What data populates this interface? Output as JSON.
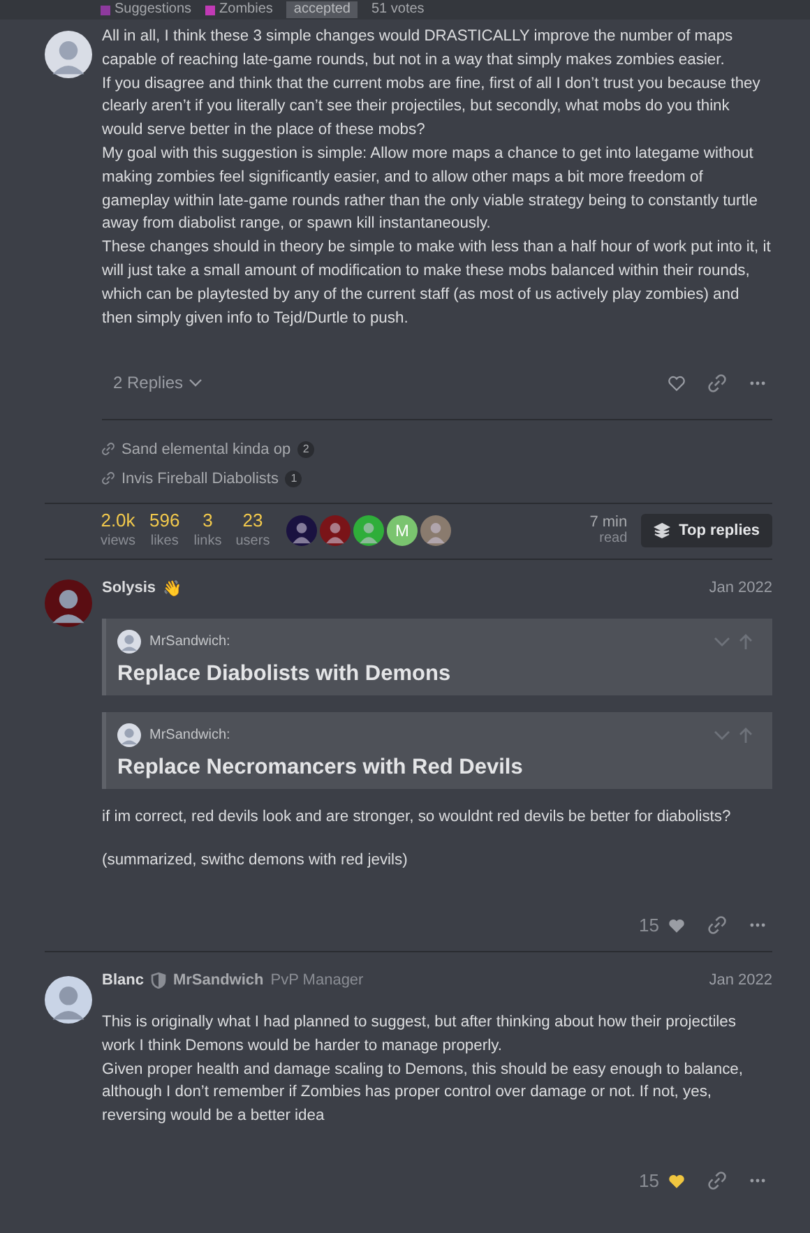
{
  "topic_bar": {
    "tags": [
      {
        "name": "Suggestions",
        "color": "#8e3a9e"
      },
      {
        "name": "Zombies",
        "color": "#c13ab5"
      }
    ],
    "status": "accepted",
    "votes": "51 votes"
  },
  "first_post": {
    "paragraphs": [
      "All in all, I think these 3 simple changes would DRASTICALLY improve the number of maps capable of reaching late-game rounds, but not in a way that simply makes zombies easier.",
      "If you disagree and think that the current mobs are fine, first of all I don’t trust you because they clearly aren’t if you literally can’t see their projectiles, but secondly, what mobs do you think would serve better in the place of these mobs?",
      "My goal with this suggestion is simple: Allow more maps a chance to get into lategame without making zombies feel significantly easier, and to allow other maps a bit more freedom of gameplay within late-game rounds rather than the only viable strategy being to constantly turtle away from diabolist range, or spawn kill instantaneously.",
      "These changes should in theory be simple to make with less than a half hour of work put into it, it will just take a small amount of modification to make these mobs balanced within their rounds, which can be playtested by any of the current staff (as most of us actively play zombies) and then simply given info to Tejd/Durtle to push."
    ],
    "replies_button": "2 Replies",
    "liked": false
  },
  "linked_topics": [
    {
      "title": "Sand elemental kinda op",
      "count": "2"
    },
    {
      "title": "Invis Fireball Diabolists",
      "count": "1"
    }
  ],
  "stats": [
    {
      "value": "2.0k",
      "label": "views"
    },
    {
      "value": "596",
      "label": "likes"
    },
    {
      "value": "3",
      "label": "links"
    },
    {
      "value": "23",
      "label": "users"
    }
  ],
  "participants": [
    {
      "color": "#1a1240"
    },
    {
      "color": "#7a1418"
    },
    {
      "color": "#2fae3a"
    },
    {
      "color": "#7ac46f",
      "letter": "M"
    },
    {
      "color": "#8a7b6e"
    }
  ],
  "read_time": {
    "value": "7 min",
    "label": "read"
  },
  "top_replies_button": "Top replies",
  "replies": [
    {
      "author": "Solysis",
      "emoji": "👋",
      "date": "Jan 2022",
      "quotes": [
        {
          "author": "MrSandwich:",
          "title": "Replace Diabolists with Demons"
        },
        {
          "author": "MrSandwich:",
          "title": "Replace Necromancers with Red Devils"
        }
      ],
      "paragraphs": [
        "if im correct, red devils look and are stronger, so wouldnt red devils be better for diabolists?",
        "(summarized, swithc demons with red jevils)"
      ],
      "like_count": "15",
      "liked": false
    },
    {
      "author": "Blanc",
      "moderator": true,
      "group": "MrSandwich",
      "user_title": "PvP Manager",
      "date": "Jan 2022",
      "paragraphs": [
        "This is originally what I had planned to suggest, but after thinking about how their projectiles work I think Demons would be harder to manage properly.\nGiven proper health and damage scaling to Demons, this should be easy enough to balance, although I don’t remember if Zombies has proper control over damage or not. If not, yes, reversing would be a better idea"
      ],
      "like_count": "15",
      "liked": true
    }
  ]
}
